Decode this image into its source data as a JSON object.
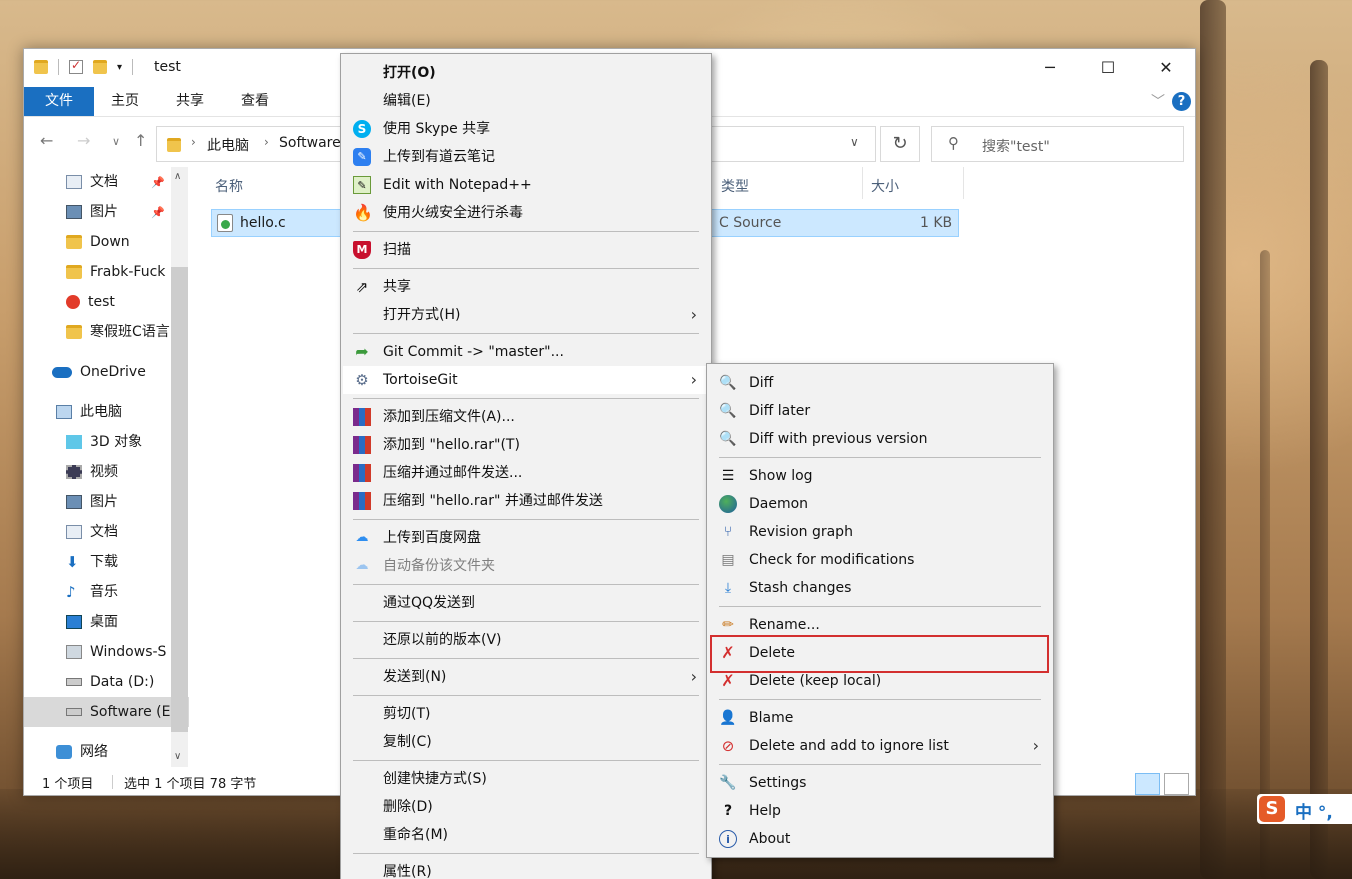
{
  "window": {
    "title": "test",
    "ribbon_tabs": [
      "文件",
      "主页",
      "共享",
      "查看"
    ],
    "breadcrumb": [
      "此电脑",
      "Software"
    ],
    "search_placeholder": "搜索\"test\"",
    "controls": {
      "minimize": "─",
      "maximize": "☐",
      "close": "✕"
    }
  },
  "nav": {
    "items": [
      {
        "label": "文档",
        "pinned": true
      },
      {
        "label": "图片",
        "pinned": true
      },
      {
        "label": "Down"
      },
      {
        "label": "Frabk-Fuck"
      },
      {
        "label": "test"
      },
      {
        "label": "寒假班C语言"
      },
      {
        "label": "OneDrive"
      },
      {
        "label": "此电脑"
      },
      {
        "label": "3D 对象"
      },
      {
        "label": "视频"
      },
      {
        "label": "图片"
      },
      {
        "label": "文档"
      },
      {
        "label": "下载"
      },
      {
        "label": "音乐"
      },
      {
        "label": "桌面"
      },
      {
        "label": "Windows-S"
      },
      {
        "label": "Data (D:)"
      },
      {
        "label": "Software (E"
      },
      {
        "label": "网络"
      }
    ]
  },
  "files": {
    "columns": {
      "name": "名称",
      "type": "类型",
      "size": "大小"
    },
    "rows": [
      {
        "name": "hello.c",
        "type": "C Source",
        "size": "1 KB"
      }
    ]
  },
  "status": {
    "count": "1 个项目",
    "selection": "选中 1 个项目  78 字节"
  },
  "context_menu": {
    "items": [
      {
        "label": "打开(O)",
        "icon": "none",
        "bold": true
      },
      {
        "label": "编辑(E)",
        "icon": "none"
      },
      {
        "label": "使用 Skype 共享",
        "icon": "skype-icon"
      },
      {
        "label": "上传到有道云笔记",
        "icon": "youdao-icon"
      },
      {
        "label": "Edit with Notepad++",
        "icon": "notepad-icon"
      },
      {
        "label": "使用火绒安全进行杀毒",
        "icon": "huorong-icon"
      },
      {
        "label": "扫描",
        "icon": "mcafee-icon"
      },
      {
        "label": "共享",
        "icon": "share-icon"
      },
      {
        "label": "打开方式(H)",
        "icon": "none",
        "submenu": true
      },
      {
        "label": "Git Commit -> \"master\"...",
        "icon": "git-commit-icon"
      },
      {
        "label": "TortoiseGit",
        "icon": "tortoisegit-icon",
        "submenu": true,
        "highlighted": true
      },
      {
        "label": "添加到压缩文件(A)...",
        "icon": "winrar-icon"
      },
      {
        "label": "添加到 \"hello.rar\"(T)",
        "icon": "winrar-icon"
      },
      {
        "label": "压缩并通过邮件发送...",
        "icon": "winrar-icon"
      },
      {
        "label": "压缩到 \"hello.rar\" 并通过邮件发送",
        "icon": "winrar-icon"
      },
      {
        "label": "上传到百度网盘",
        "icon": "baidu-icon"
      },
      {
        "label": "自动备份该文件夹",
        "icon": "baidu-icon",
        "disabled": true
      },
      {
        "label": "通过QQ发送到",
        "icon": "none"
      },
      {
        "label": "还原以前的版本(V)",
        "icon": "none"
      },
      {
        "label": "发送到(N)",
        "icon": "none",
        "submenu": true
      },
      {
        "label": "剪切(T)",
        "icon": "none"
      },
      {
        "label": "复制(C)",
        "icon": "none"
      },
      {
        "label": "创建快捷方式(S)",
        "icon": "none"
      },
      {
        "label": "删除(D)",
        "icon": "none"
      },
      {
        "label": "重命名(M)",
        "icon": "none"
      },
      {
        "label": "属性(R)",
        "icon": "none"
      }
    ]
  },
  "submenu": {
    "items": [
      {
        "label": "Diff",
        "icon": "magnifier-icon"
      },
      {
        "label": "Diff later",
        "icon": "magnifier-icon"
      },
      {
        "label": "Diff with previous version",
        "icon": "magnifier-icon"
      },
      {
        "label": "Show log",
        "icon": "log-icon"
      },
      {
        "label": "Daemon",
        "icon": "globe-icon"
      },
      {
        "label": "Revision graph",
        "icon": "graph-icon"
      },
      {
        "label": "Check for modifications",
        "icon": "check-mods-icon"
      },
      {
        "label": "Stash changes",
        "icon": "stash-icon"
      },
      {
        "label": "Rename...",
        "icon": "pencil-icon"
      },
      {
        "label": "Delete",
        "icon": "delete-x-icon",
        "boxed": true
      },
      {
        "label": "Delete (keep local)",
        "icon": "delete-x-icon"
      },
      {
        "label": "Blame",
        "icon": "blame-icon"
      },
      {
        "label": "Delete and add to ignore list",
        "icon": "ignore-icon",
        "submenu": true
      },
      {
        "label": "Settings",
        "icon": "wrench-icon"
      },
      {
        "label": "Help",
        "icon": "help-icon"
      },
      {
        "label": "About",
        "icon": "info-icon"
      }
    ]
  },
  "ime": {
    "label": "中 °,"
  },
  "colors": {
    "accent": "#1a6fc1",
    "selection": "#cce8ff",
    "highlight_box": "#d32f2f"
  }
}
